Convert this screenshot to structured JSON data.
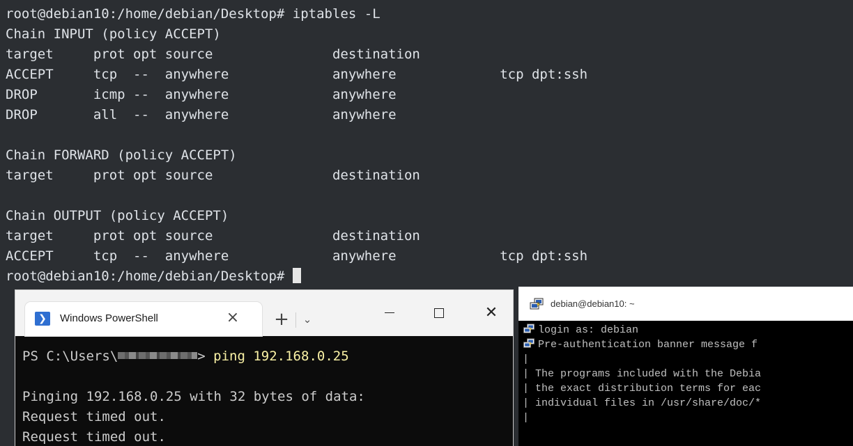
{
  "main_terminal": {
    "lines": [
      "root@debian10:/home/debian/Desktop# iptables -L",
      "Chain INPUT (policy ACCEPT)",
      "target     prot opt source               destination",
      "ACCEPT     tcp  --  anywhere             anywhere             tcp dpt:ssh",
      "DROP       icmp --  anywhere             anywhere",
      "DROP       all  --  anywhere             anywhere",
      "",
      "Chain FORWARD (policy ACCEPT)",
      "target     prot opt source               destination",
      "",
      "Chain OUTPUT (policy ACCEPT)",
      "target     prot opt source               destination",
      "ACCEPT     tcp  --  anywhere             anywhere             tcp dpt:ssh"
    ],
    "prompt": "root@debian10:/home/debian/Desktop# "
  },
  "powershell": {
    "tab_title": "Windows PowerShell",
    "tab_close": "×",
    "new_tab": "+",
    "dropdown": "⌄",
    "close": "✕",
    "prompt_prefix": "PS C:\\Users\\",
    "prompt_suffix": "> ",
    "command": "ping 192.168.0.25",
    "output": [
      "",
      "Pinging 192.168.0.25 with 32 bytes of data:",
      "Request timed out.",
      "Request timed out."
    ]
  },
  "putty": {
    "title": "debian@debian10: ~",
    "lines": [
      {
        "icon": true,
        "text": "login as: debian"
      },
      {
        "icon": true,
        "text": "Pre-authentication banner message f"
      },
      {
        "icon": false,
        "text": "|"
      },
      {
        "icon": false,
        "text": "| The programs included with the Debia"
      },
      {
        "icon": false,
        "text": "| the exact distribution terms for eac"
      },
      {
        "icon": false,
        "text": "| individual files in /usr/share/doc/*"
      },
      {
        "icon": false,
        "text": "|"
      }
    ]
  },
  "colors": {
    "main_terminal_bg": "#2b2e32",
    "main_terminal_fg": "#dfe3e8",
    "powershell_bg": "#0c0c0c",
    "powershell_command": "#f9f1a5",
    "putty_bg": "#000000"
  }
}
